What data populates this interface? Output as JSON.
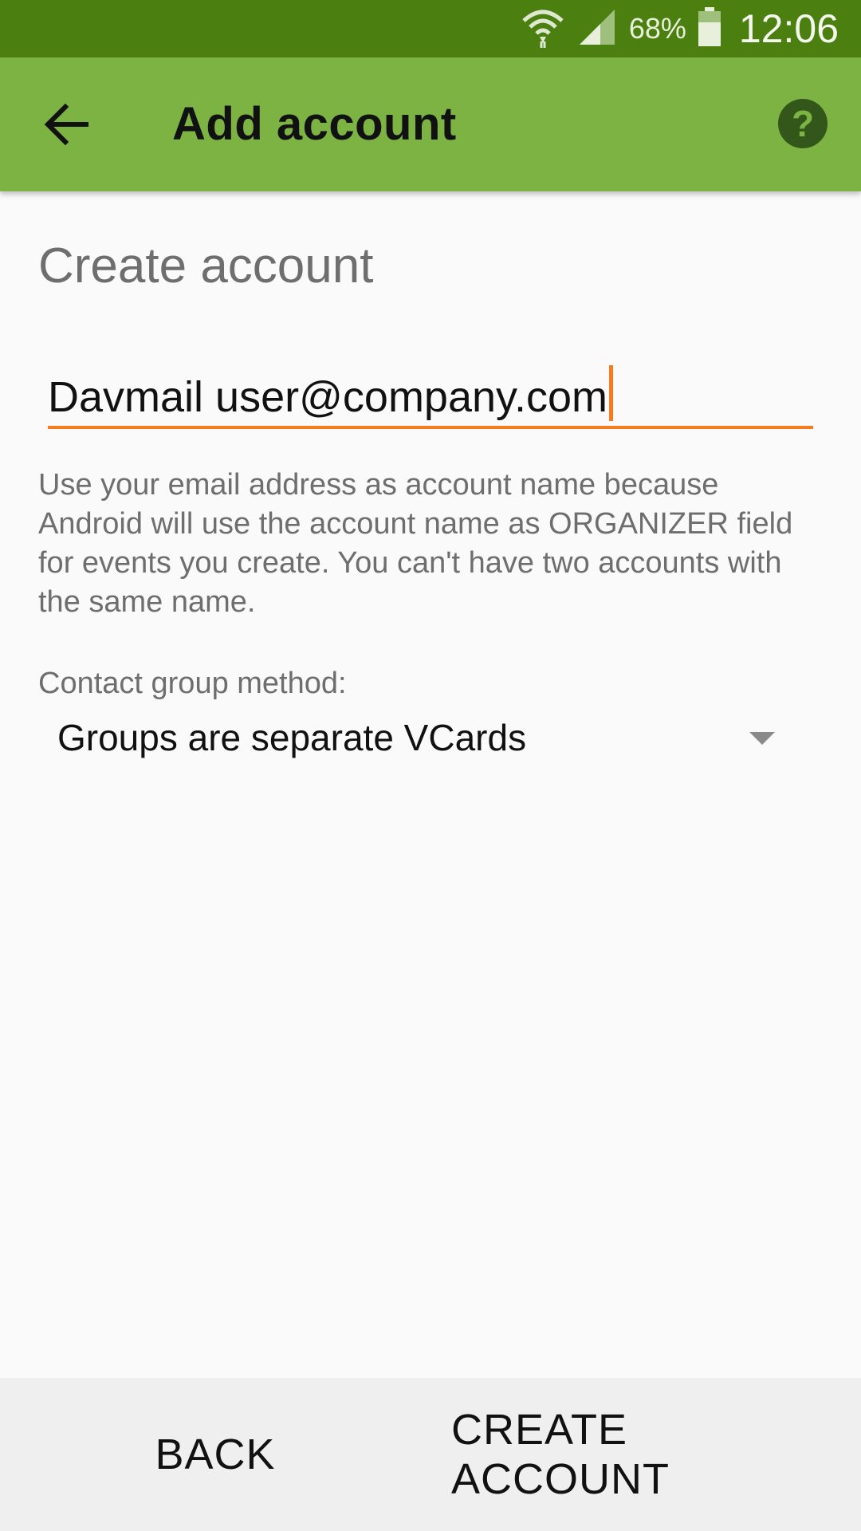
{
  "status_bar": {
    "battery_percent": "68%",
    "time": "12:06"
  },
  "app_bar": {
    "title": "Add account"
  },
  "form": {
    "section_title": "Create account",
    "account_name_value": "Davmail user@company.com",
    "help_text": "Use your email address as account name because Android will use the account name as ORGANIZER field for events you create. You can't have two accounts with the same name.",
    "contact_group_label": "Contact group method:",
    "contact_group_selected": "Groups are separate VCards"
  },
  "buttons": {
    "back_label": "BACK",
    "create_label": "CREATE ACCOUNT"
  },
  "colors": {
    "status_bar": "#4b7f10",
    "app_bar": "#7cb342",
    "accent": "#f57d20",
    "help_icon_bg": "#33561a",
    "button_bar": "#efefef"
  },
  "icons": [
    "wifi-icon",
    "signal-icon",
    "battery-icon",
    "back-arrow-icon",
    "help-icon",
    "dropdown-caret-icon"
  ]
}
